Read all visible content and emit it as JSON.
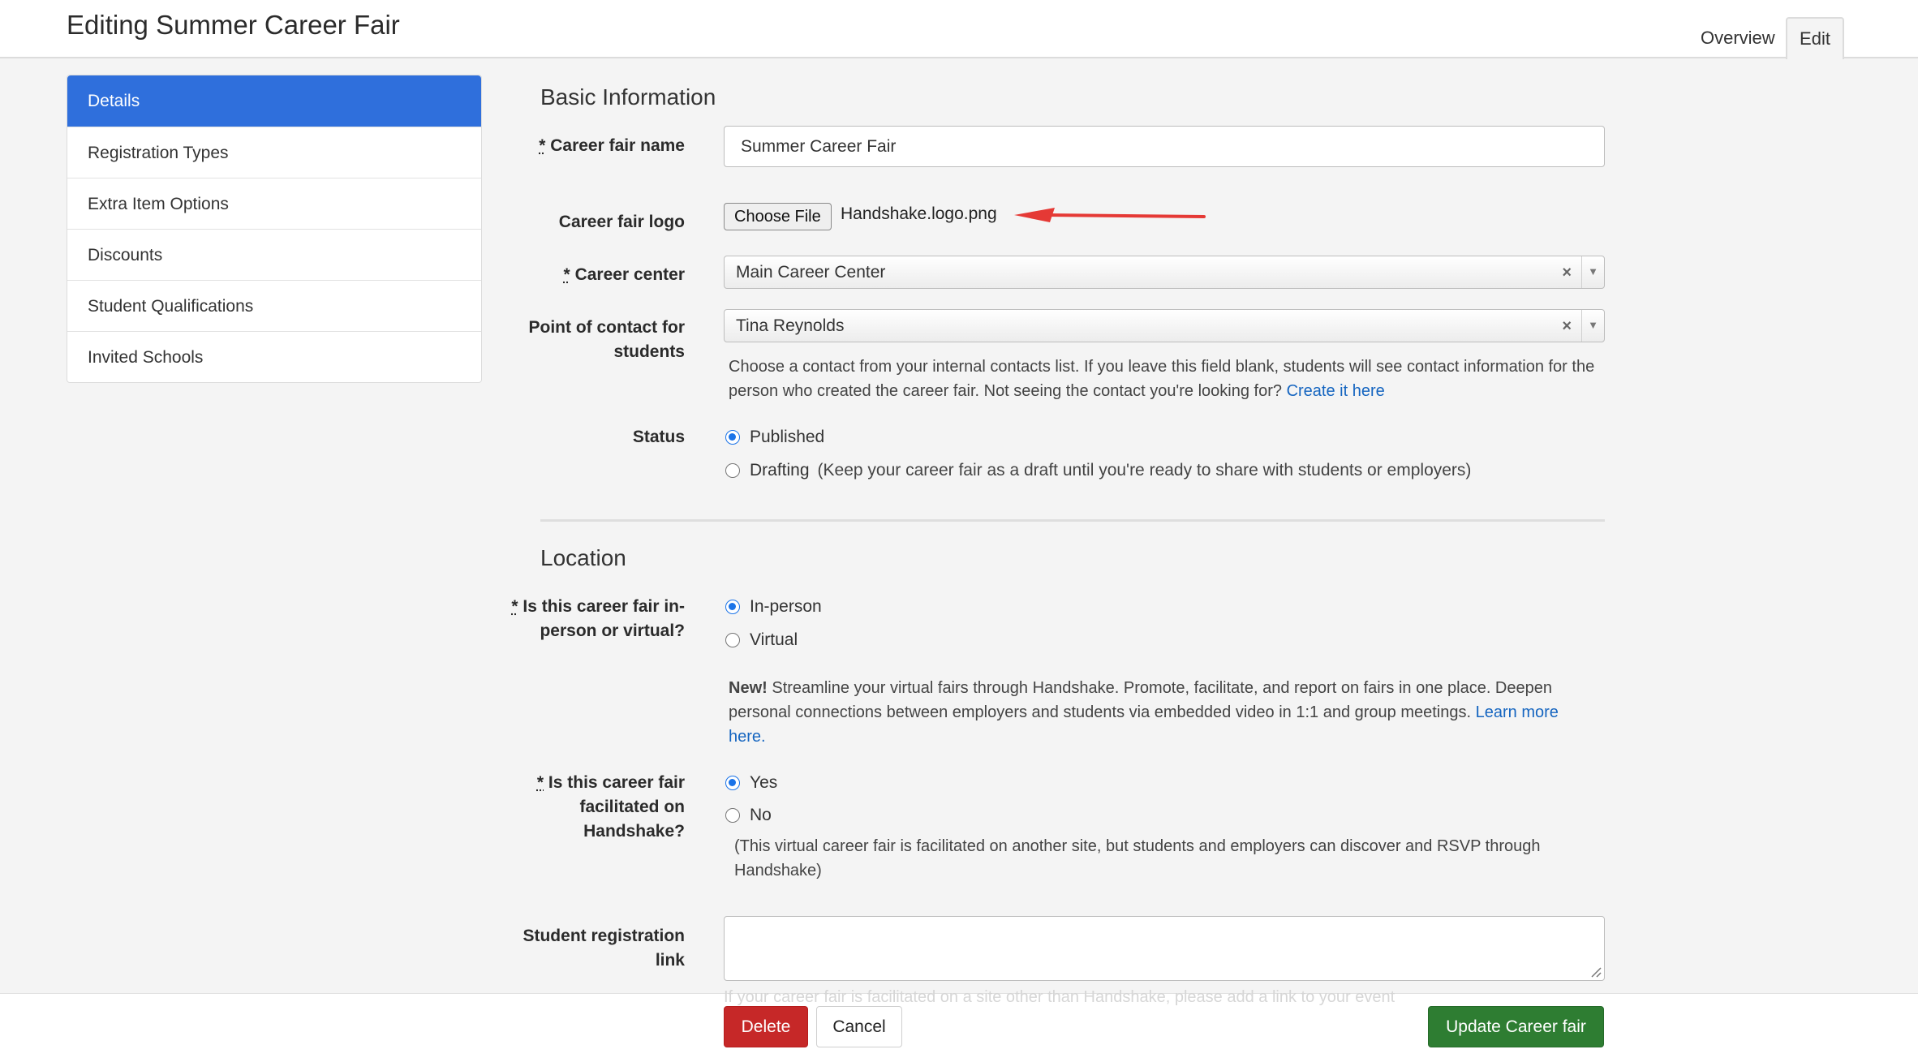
{
  "header": {
    "title": "Editing Summer Career Fair",
    "tabs": {
      "overview": "Overview",
      "edit": "Edit"
    }
  },
  "sidebar": {
    "items": [
      {
        "label": "Details",
        "active": true
      },
      {
        "label": "Registration Types"
      },
      {
        "label": "Extra Item Options"
      },
      {
        "label": "Discounts"
      },
      {
        "label": "Student Qualifications"
      },
      {
        "label": "Invited Schools"
      }
    ]
  },
  "basic": {
    "title": "Basic Information",
    "name_label_req": "*",
    "name_label": "Career fair name",
    "name_value": "Summer Career Fair",
    "logo_label": "Career fair logo",
    "choose_file": "Choose File",
    "file_name": "Handshake.logo.png",
    "center_label_req": "*",
    "center_label": "Career center",
    "center_value": "Main Career Center",
    "contact_label": "Point of contact for students",
    "contact_value": "Tina Reynolds",
    "contact_help": "Choose a contact from your internal contacts list. If you leave this field blank, students will see contact information for the person who created the career fair. Not seeing the contact you're looking for?",
    "contact_help_link": "Create it here",
    "status_label": "Status",
    "status_published": "Published",
    "status_drafting": "Drafting",
    "status_drafting_note": "(Keep your career fair as a draft until you're ready to share with students or employers)"
  },
  "location": {
    "title": "Location",
    "mode_label_req": "*",
    "mode_label": "Is this career fair in-person or virtual?",
    "mode_inperson": "In-person",
    "mode_virtual": "Virtual",
    "promo_bold": "New!",
    "promo_text": "Streamline your virtual fairs through Handshake. Promote, facilitate, and report on fairs in one place. Deepen personal connections between employers and students via embedded video in 1:1 and group meetings.",
    "promo_link": "Learn more here.",
    "handshake_label_req": "*",
    "handshake_label": "Is this career fair facilitated on Handshake?",
    "handshake_yes": "Yes",
    "handshake_no": "No",
    "handshake_no_note": "(This virtual career fair is facilitated on another site, but students and employers can discover and RSVP through Handshake)",
    "reg_link_label": "Student registration link",
    "reg_link_value": "",
    "reg_link_hint": "If your career fair is facilitated on a site other than Handshake, please add a link to your event"
  },
  "footer": {
    "delete": "Delete",
    "cancel": "Cancel",
    "update": "Update Career fair"
  },
  "colors": {
    "primary": "#2f6fdc",
    "delete": "#c62828",
    "update": "#2e7d32",
    "link": "#1565c0",
    "annotation_arrow": "#e53935"
  }
}
